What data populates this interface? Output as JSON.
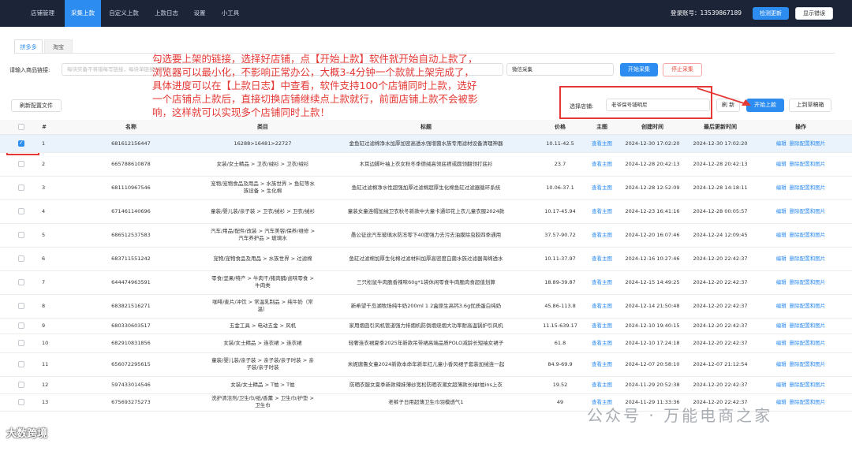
{
  "nav": {
    "items": [
      "店铺管理",
      "采集上款",
      "自定义上款",
      "上款日志",
      "设置",
      "小工具"
    ],
    "active_index": 1,
    "account_label": "登录账号：13539867189",
    "check_update": "检测更新",
    "show_error": "显示错误"
  },
  "tabs": [
    "拼多多",
    "淘宝"
  ],
  "filter": {
    "input_label": "请输入商品链接:",
    "input_placeholder": "每块实备不将错每写链接，每块单链接(多条)",
    "wechat_label": "微信采集",
    "start_collect": "开始采集",
    "stop_collect": "停止采集",
    "refresh_config": "刷新配置文件",
    "store_label": "选择店铺:",
    "store_value": "老爷保号铺明尼",
    "refresh": "刷 新",
    "start_upload": "开始上款",
    "upload_draft": "上到草稿箱"
  },
  "annotation": "勾选要上架的链接，选择好店铺，点【开始上款】软件就开始自动上款了，浏览器可以最小化，不影响正常办公，大概3-4分钟一个款就上架完成了，具体进度可以在【上款日志】中查看，软件支持100个店铺同时上款，选好一个店铺点上款后，直接切换店铺继续点上款就行，前面店铺上款不会被影响，这样就可以实现多个店铺同时上款！",
  "table": {
    "headers": [
      "#",
      "名称",
      "类目",
      "标题",
      "价格",
      "主图",
      "创建时间",
      "最后更新时间",
      "操作"
    ],
    "view_main": "查看主图",
    "op_edit": "编辑",
    "op_delete": "删除配置和图片",
    "rows": [
      {
        "idx": "1",
        "name": "681612156447",
        "cat": "16288>16481>22727",
        "title": "金鱼缸过滤棉净水加厚加密高透水强增菌水族专用滤材设备清理神器",
        "price": "10.11-42.5",
        "created": "2024-12-30 17:02:20",
        "updated": "2024-12-30 17:02:20",
        "checked": true
      },
      {
        "idx": "2",
        "name": "665788610878",
        "cat": "女装/女士精品 > 卫衣/绒衫 > 卫衣/绒衫",
        "title": "木耳边脚叶袖上衣女秋冬季德绒高领底襟或圆领翻领打底衫",
        "price": "23.7",
        "created": "2024-12-28 20:42:13",
        "updated": "2024-12-28 20:42:13",
        "checked": false
      },
      {
        "idx": "3",
        "name": "681110967546",
        "cat": "宠物/宠物食品及用品 > 水族世界 > 鱼缸等水族设备 > 生化棉",
        "title": "鱼缸过滤棉净水性超强加厚过滤棉超厚生化棉鱼缸过滤器循环系统",
        "price": "10.06-37.1",
        "created": "2024-12-28 12:52:09",
        "updated": "2024-12-28 14:18:11",
        "checked": false
      },
      {
        "idx": "4",
        "name": "671461140696",
        "cat": "童装/婴儿装/亲子装 > 卫衣/绒衫 > 卫衣/绒衫",
        "title": "童装女童连帽加绒卫衣秋冬新款中大童卡通印花上衣儿童衣服2024款",
        "price": "10.17-45.94",
        "created": "2024-12-23 16:41:16",
        "updated": "2024-12-28 00:05:57",
        "checked": false
      },
      {
        "idx": "5",
        "name": "686512537583",
        "cat": "汽车/用品/配件/改装 > 汽车美容/保养/维修 > 汽车养护品 > 玻璃水",
        "title": "愚公征途汽车玻璃水防冻零下40度强力去污去油膜除虫胶四季通用",
        "price": "37.57-90.72",
        "created": "2024-12-20 16:07:46",
        "updated": "2024-12-24 12:09:45",
        "checked": false
      },
      {
        "idx": "6",
        "name": "683711551242",
        "cat": "宠物/宠物食品及用品 > 水族世界 > 过滤棉",
        "title": "鱼缸过滤棉加厚生化棉过滤材料加厚高密度白菌水族过滤器海绵透水",
        "price": "10.11-37.97",
        "created": "2024-12-16 10:27:46",
        "updated": "2024-12-20 22:42:37",
        "checked": false
      },
      {
        "idx": "7",
        "name": "644474963591",
        "cat": "零食/坚果/特产 > 牛肉干/猪肉脯/卤味零食 > 牛肉类",
        "title": "三只松鼠牛肉脆香辣味60g*1袋休闲零食牛肉脆肉食超值划算",
        "price": "18.89-39.87",
        "created": "2024-12-15 14:49:25",
        "updated": "2024-12-20 22:42:37",
        "checked": false
      },
      {
        "idx": "8",
        "name": "683821516271",
        "cat": "咖啡/麦片/冲饮 > 常温乳制品 > 纯牛奶（常温）",
        "title": "新希望千岛湖牧场纯牛奶200ml 1 2盒原生高钙3.6g优质蛋白纯奶",
        "price": "45.86-113.8",
        "created": "2024-12-14 21:50:48",
        "updated": "2024-12-20 22:42:37",
        "checked": false
      },
      {
        "idx": "9",
        "name": "680330603517",
        "cat": "五金工具 > 电动五金 > 风机",
        "title": "家用烟囱引风机管道强力排烟机防倒烟烧烟大功率耐高温锅炉引风机",
        "price": "11.15-639.17",
        "created": "2024-12-10 19:40:15",
        "updated": "2024-12-20 22:42:37",
        "checked": false
      },
      {
        "idx": "10",
        "name": "682910831856",
        "cat": "女装/女士精品 > 连衣裙 > 连衣裙",
        "title": "轻奢连衣裙夏季2025年新款吊带裙高端品质POLO减龄长短袖女裙子",
        "price": "61.8",
        "created": "2024-12-10 17:24:18",
        "updated": "2024-12-20 22:42:37",
        "checked": false
      },
      {
        "idx": "11",
        "name": "656072295615",
        "cat": "童装/婴儿装/亲子装 > 亲子装/亲子时装 > 亲子装/亲子时装",
        "title": "米妮唐鲁女童2024新款本命年新年红儿童小香风裙子套装加绒连一起",
        "price": "84.9-69.9",
        "created": "2024-12-07 20:58:10",
        "updated": "2024-12-07 21:12:54",
        "checked": false
      },
      {
        "idx": "12",
        "name": "597433014546",
        "cat": "女装/女士精品 > T恤 > T恤",
        "title": "防晒衣服女夏季新款辣妹薄纱宽松防晒衣潮女超薄款长袖t恤ins上衣",
        "price": "19.52",
        "created": "2024-11-29 20:52:38",
        "updated": "2024-12-20 22:42:37",
        "checked": false
      },
      {
        "idx": "13",
        "name": "675693275273",
        "cat": "洗护清洁剂/卫生巾/纸/香薰 > 卫生巾/护垫 > 卫生巾",
        "title": "老裤子日用超薄卫生巾羽模透气1",
        "price": "49",
        "created": "2024-11-29 11:33:36",
        "updated": "2024-12-20 22:42:37",
        "checked": false
      }
    ]
  },
  "watermarks": {
    "left": "大数跨境",
    "right": "公众号 · 万能电商之家"
  },
  "colors": {
    "nav_bg": "#1c2438",
    "primary": "#2d8cf0",
    "annotation": "#e53935"
  }
}
